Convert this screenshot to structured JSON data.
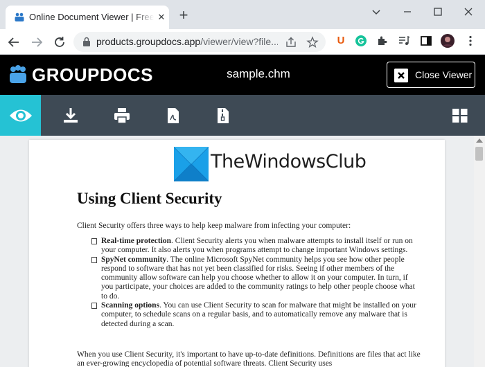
{
  "browser": {
    "tab": {
      "title": "Online Document Viewer | Free GroupDocs Apps"
    },
    "address": {
      "host": "products.groupdocs.app",
      "path": "/viewer/view?file..."
    },
    "extensions": {
      "u_label": "U"
    }
  },
  "viewer": {
    "brand": "GROUPDOCS",
    "file_name": "sample.chm",
    "close_label": "Close Viewer"
  },
  "watermark": {
    "text": "TheWindowsClub"
  },
  "document": {
    "title": "Using Client Security",
    "intro": "Client Security offers three ways to help keep malware from infecting your computer:",
    "bullets": [
      {
        "bold": "Real-time protection",
        "text": ". Client Security alerts you when malware attempts to install itself or run on your computer. It also alerts you when programs attempt to change important Windows settings."
      },
      {
        "bold": "SpyNet community",
        "text": ". The online Microsoft SpyNet community helps you see how other people respond to software that has not yet been classified for risks. Seeing if other members of the community allow software can help you choose whether to allow it on your computer. In turn, if you participate, your choices are added to the community ratings to help other people choose what to do."
      },
      {
        "bold": "Scanning options",
        "text": ". You can use Client Security to scan for malware that might be installed on your computer, to schedule scans on a regular basis, and to automatically remove any malware that is detected during a scan."
      }
    ],
    "paragraph": "When you use Client Security, it's important to have up-to-date definitions. Definitions are files that act like an ever-growing encyclopedia of potential software threats. Client Security uses"
  },
  "colors": {
    "toolbar": "#3e4a55",
    "active_tool": "#25c2d4",
    "header": "#000000"
  }
}
